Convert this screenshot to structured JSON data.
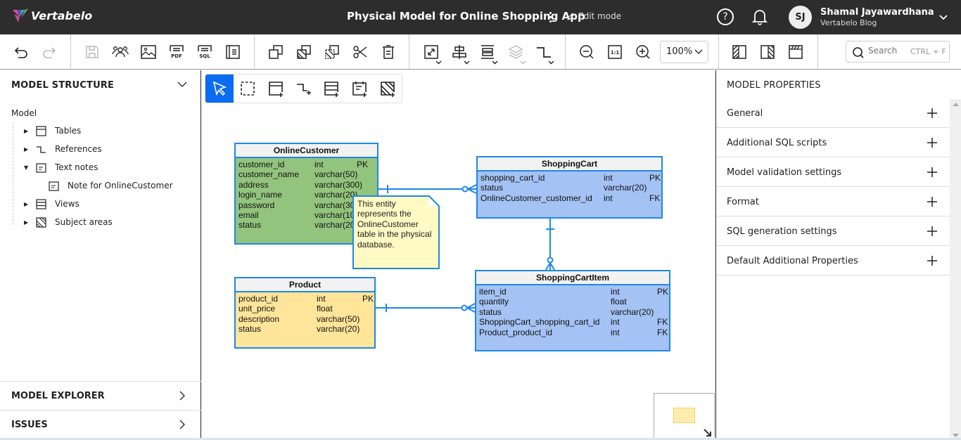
{
  "app": {
    "logo_text": "Vertabelo",
    "document_title": "Physical Model for Online Shopping App",
    "mode_label": "Edit mode",
    "help_label": "?",
    "user": {
      "initials": "SJ",
      "name": "Shamal Jayawardhana",
      "org": "Vertabelo Blog"
    }
  },
  "toolbar": {
    "zoom_level": "100%",
    "search_placeholder": "Search",
    "search_shortcut": "CTRL + F",
    "buttons": [
      "undo",
      "redo",
      "save",
      "share",
      "export-image",
      "export-pdf",
      "export-sql",
      "model-summary",
      "duplicate",
      "copy-style",
      "paste-style",
      "cut",
      "delete",
      "auto-fit",
      "align",
      "distribute",
      "layers",
      "line-style",
      "zoom-out",
      "actual-size",
      "zoom-in",
      "left-panel",
      "right-panel",
      "toggle-toolbar"
    ]
  },
  "left_panel": {
    "title": "MODEL STRUCTURE",
    "root": "Model",
    "items": [
      {
        "label": "Tables",
        "expanded": false
      },
      {
        "label": "References",
        "expanded": false
      },
      {
        "label": "Text notes",
        "expanded": true,
        "children": [
          "Note for OnlineCustomer"
        ]
      },
      {
        "label": "Views",
        "expanded": false
      },
      {
        "label": "Subject areas",
        "expanded": false
      }
    ],
    "model_explorer": "MODEL EXPLORER",
    "issues": "ISSUES"
  },
  "canvas": {
    "tools": [
      "select",
      "select-area",
      "add-table",
      "add-reference",
      "add-view",
      "add-text-note",
      "add-subject-area"
    ],
    "entities": [
      {
        "name": "OnlineCustomer",
        "color": "#93c47d",
        "columns": [
          {
            "name": "customer_id",
            "type": "int",
            "key": "PK"
          },
          {
            "name": "customer_name",
            "type": "varchar(50)",
            "key": ""
          },
          {
            "name": "address",
            "type": "varchar(300)",
            "key": ""
          },
          {
            "name": "login_name",
            "type": "varchar(20)",
            "key": ""
          },
          {
            "name": "password",
            "type": "varchar(30)",
            "key": ""
          },
          {
            "name": "email",
            "type": "varchar(10",
            "key": ""
          },
          {
            "name": "status",
            "type": "varchar(20",
            "key": ""
          }
        ]
      },
      {
        "name": "ShoppingCart",
        "color": "#a4c2f4",
        "columns": [
          {
            "name": "shopping_cart_id",
            "type": "int",
            "key": "PK"
          },
          {
            "name": "status",
            "type": "varchar(20)",
            "key": ""
          },
          {
            "name": "OnlineCustomer_customer_id",
            "type": "int",
            "key": "FK"
          }
        ]
      },
      {
        "name": "Product",
        "color": "#ffe599",
        "columns": [
          {
            "name": "product_id",
            "type": "int",
            "key": "PK"
          },
          {
            "name": "unit_price",
            "type": "float",
            "key": ""
          },
          {
            "name": "description",
            "type": "varchar(50)",
            "key": ""
          },
          {
            "name": "status",
            "type": "varchar(20)",
            "key": ""
          }
        ]
      },
      {
        "name": "ShoppingCartItem",
        "color": "#a4c2f4",
        "columns": [
          {
            "name": "item_id",
            "type": "int",
            "key": "PK"
          },
          {
            "name": "quantity",
            "type": "float",
            "key": ""
          },
          {
            "name": "status",
            "type": "varchar(20)",
            "key": ""
          },
          {
            "name": "ShoppingCart_shopping_cart_id",
            "type": "int",
            "key": "FK"
          },
          {
            "name": "Product_product_id",
            "type": "int",
            "key": "FK"
          }
        ]
      }
    ],
    "note": "This entity represents the OnlineCustomer table in the physical database.",
    "accent_color": "#1e88e5"
  },
  "right_panel": {
    "title": "MODEL PROPERTIES",
    "sections": [
      "General",
      "Additional SQL scripts",
      "Model validation settings",
      "Format",
      "SQL generation settings",
      "Default Additional Properties"
    ]
  }
}
